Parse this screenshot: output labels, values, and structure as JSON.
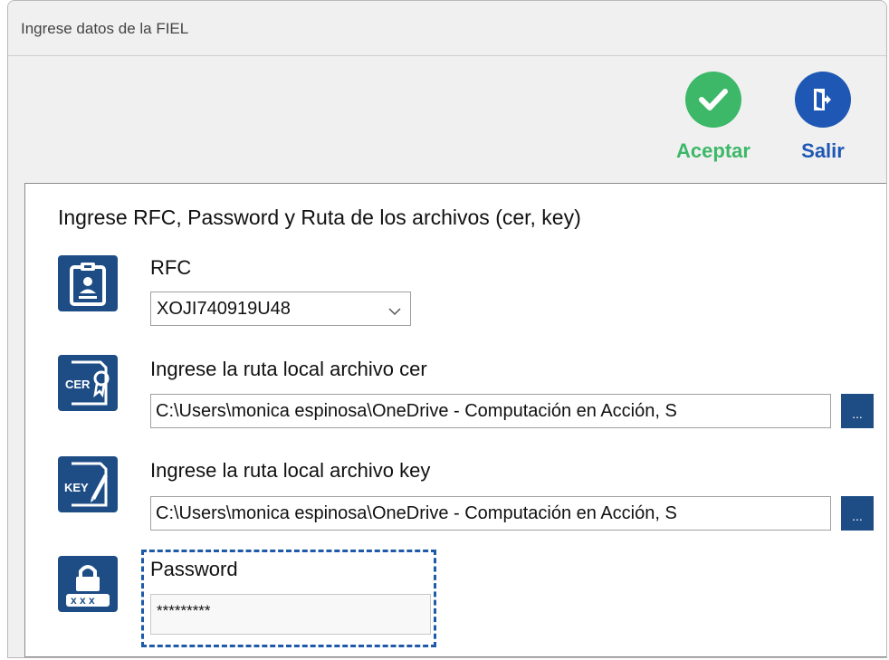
{
  "window": {
    "title": "Ingrese datos de la FIEL"
  },
  "toolbar": {
    "accept_label": "Aceptar",
    "exit_label": "Salir",
    "accept_color": "#3cb868",
    "exit_color": "#1f58b4",
    "accept_icon": "checkmark-icon",
    "exit_icon": "exit-door-icon"
  },
  "form": {
    "heading": "Ingrese RFC, Password y Ruta de los archivos (cer, key)",
    "rfc": {
      "label": "RFC",
      "value": "XOJI740919U48",
      "icon": "id-badge-icon"
    },
    "cer": {
      "label": "Ingrese la ruta local archivo cer",
      "value": "C:\\Users\\monica espinosa\\OneDrive - Computación en Acción, S",
      "browse_label": "...",
      "icon": "certificate-file-icon",
      "icon_text": "CER"
    },
    "key": {
      "label": "Ingrese la ruta local archivo key",
      "value": "C:\\Users\\monica espinosa\\OneDrive - Computación en Acción, S",
      "browse_label": "...",
      "icon": "key-file-icon",
      "icon_text": "KEY"
    },
    "password": {
      "label": "Password",
      "value": "*********",
      "icon": "password-lock-icon"
    }
  },
  "colors": {
    "icon_bg": "#1e4d86",
    "focus_border": "#1e5aa8"
  }
}
